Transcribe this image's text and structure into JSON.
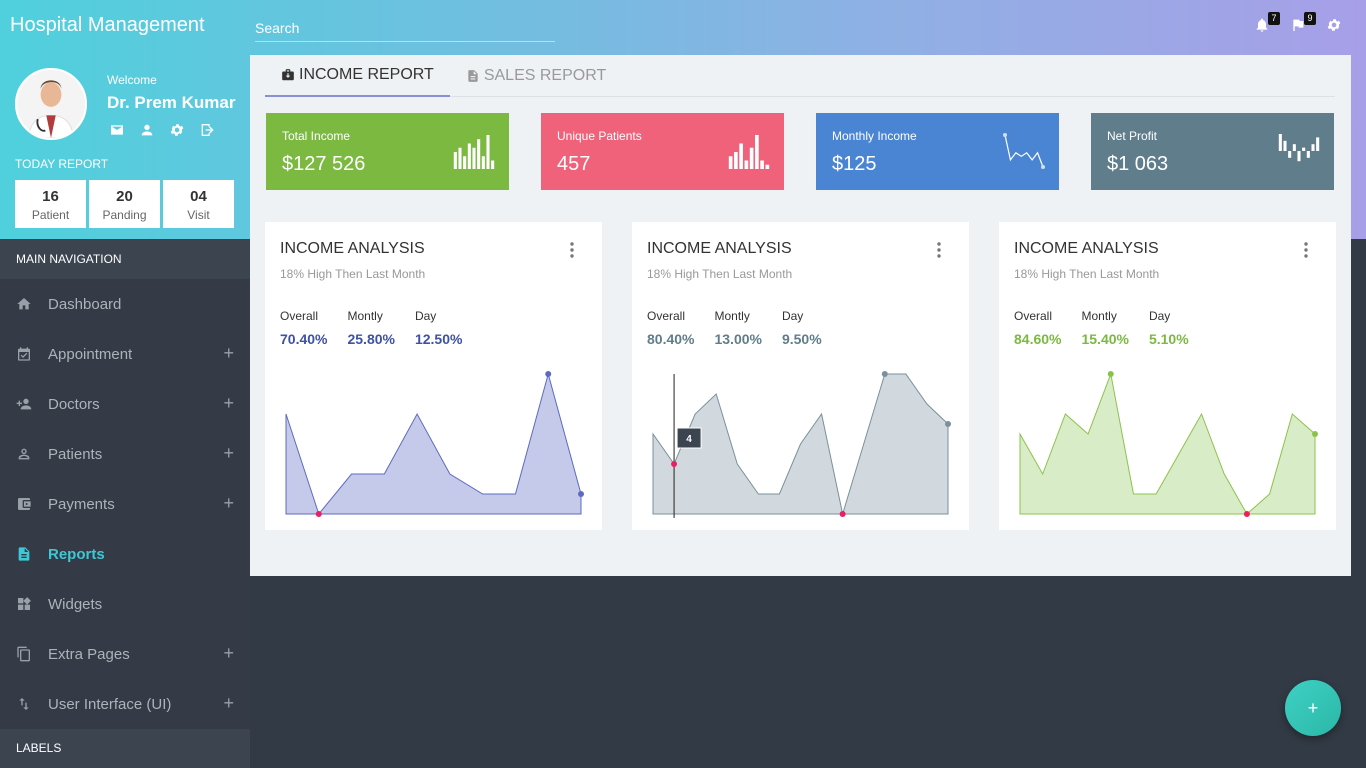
{
  "app": {
    "title": "Hospital Management"
  },
  "search": {
    "placeholder": "Search"
  },
  "top_icons": [
    {
      "name": "bell-icon",
      "badge": "7"
    },
    {
      "name": "flag-icon",
      "badge": "9"
    },
    {
      "name": "gear-icon"
    }
  ],
  "profile": {
    "welcome": "Welcome",
    "name": "Dr. Prem Kumar",
    "icons": [
      "mail-icon",
      "person-icon",
      "gear-icon",
      "logout-icon"
    ]
  },
  "today_report": {
    "title": "TODAY REPORT",
    "items": [
      {
        "value": "16",
        "label": "Patient"
      },
      {
        "value": "20",
        "label": "Panding"
      },
      {
        "value": "04",
        "label": "Visit"
      }
    ]
  },
  "sidebar": {
    "main_nav_header": "MAIN NAVIGATION",
    "labels_header": "LABELS",
    "items": [
      {
        "label": "Dashboard",
        "icon": "home-icon",
        "expandable": false,
        "active": false
      },
      {
        "label": "Appointment",
        "icon": "calendar-icon",
        "expandable": true,
        "active": false
      },
      {
        "label": "Doctors",
        "icon": "person-add-icon",
        "expandable": true,
        "active": false
      },
      {
        "label": "Patients",
        "icon": "person-outline-icon",
        "expandable": true,
        "active": false
      },
      {
        "label": "Payments",
        "icon": "wallet-icon",
        "expandable": true,
        "active": false
      },
      {
        "label": "Reports",
        "icon": "document-icon",
        "expandable": false,
        "active": true
      },
      {
        "label": "Widgets",
        "icon": "widgets-icon",
        "expandable": false,
        "active": false
      },
      {
        "label": "Extra Pages",
        "icon": "copy-icon",
        "expandable": true,
        "active": false
      },
      {
        "label": "User Interface (UI)",
        "icon": "swap-icon",
        "expandable": true,
        "active": false
      }
    ],
    "plus_symbol": "+"
  },
  "tabs": [
    {
      "label": "INCOME REPORT",
      "icon": "briefcase-icon",
      "active": true
    },
    {
      "label": "SALES REPORT",
      "icon": "file-icon",
      "active": false
    }
  ],
  "stats": [
    {
      "title": "Total Income",
      "value": "$127 526",
      "color": "#7bb941",
      "spark": "bar",
      "spark_values": [
        4,
        5,
        3,
        6,
        5,
        7,
        3,
        8,
        2
      ]
    },
    {
      "title": "Unique Patients",
      "value": "457",
      "color": "#f0627a",
      "spark": "bar",
      "spark_values": [
        3,
        4,
        6,
        2,
        5,
        8,
        2,
        1
      ]
    },
    {
      "title": "Monthly Income",
      "value": "$125",
      "color": "#4a85d4",
      "spark": "line",
      "spark_values": [
        9,
        2,
        4,
        3,
        4,
        2,
        4,
        0
      ]
    },
    {
      "title": "Net Profit",
      "value": "$1 063",
      "color": "#607d8b",
      "spark": "candle",
      "spark_values": [
        5,
        3,
        -2,
        2,
        -3,
        1,
        -2,
        2,
        4
      ]
    }
  ],
  "cards": [
    {
      "title": "INCOME ANALYSIS",
      "subtitle": "18% High Then Last Month",
      "metrics": [
        {
          "label": "Overall",
          "value": "70.40%"
        },
        {
          "label": "Montly",
          "value": "25.80%"
        },
        {
          "label": "Day",
          "value": "12.50%"
        }
      ],
      "value_color": "#3f51a5",
      "fill": "#c5c9ea",
      "stroke": "#5c6bc0"
    },
    {
      "title": "INCOME ANALYSIS",
      "subtitle": "18% High Then Last Month",
      "metrics": [
        {
          "label": "Overall",
          "value": "80.40%"
        },
        {
          "label": "Montly",
          "value": "13.00%"
        },
        {
          "label": "Day",
          "value": "9.50%"
        }
      ],
      "value_color": "#607d8b",
      "fill": "#d1d9df",
      "stroke": "#7a909c",
      "tooltip": "4"
    },
    {
      "title": "INCOME ANALYSIS",
      "subtitle": "18% High Then Last Month",
      "metrics": [
        {
          "label": "Overall",
          "value": "84.60%"
        },
        {
          "label": "Montly",
          "value": "15.40%"
        },
        {
          "label": "Day",
          "value": "5.10%"
        }
      ],
      "value_color": "#7bb941",
      "fill": "#d8ecc8",
      "stroke": "#8bc34a"
    }
  ],
  "chart_data": [
    {
      "type": "area",
      "series": [
        {
          "values": [
            5,
            0,
            2,
            2,
            5,
            2,
            1,
            1,
            7,
            1
          ]
        }
      ],
      "ylim": [
        0,
        7
      ]
    },
    {
      "type": "area",
      "series": [
        {
          "values": [
            4,
            2.5,
            5,
            6,
            2.5,
            1,
            1,
            3.5,
            5,
            0,
            3.5,
            7,
            7,
            5.5,
            4.5
          ]
        }
      ],
      "ylim": [
        0,
        7
      ]
    },
    {
      "type": "area",
      "series": [
        {
          "values": [
            4,
            2,
            5,
            4,
            7,
            1,
            1,
            3,
            5,
            2,
            0,
            1,
            5,
            4
          ]
        }
      ],
      "ylim": [
        0,
        7
      ]
    }
  ],
  "fab": {
    "label": "+"
  }
}
